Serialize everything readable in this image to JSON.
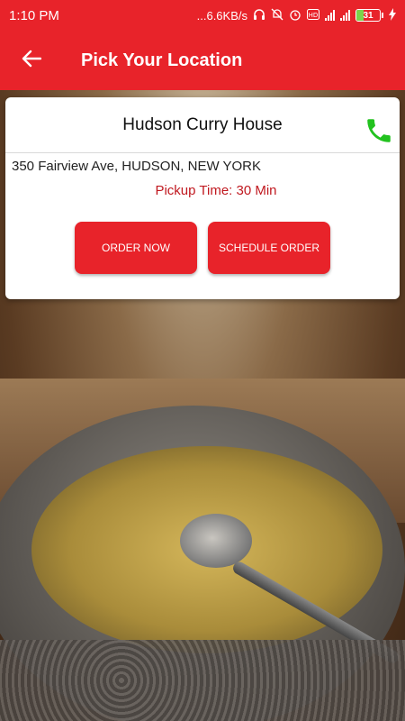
{
  "status_bar": {
    "time": "1:10 PM",
    "network_speed": "...6.6KB/s",
    "battery": "31"
  },
  "app_bar": {
    "title": "Pick Your Location"
  },
  "card": {
    "restaurant_name": "Hudson Curry House",
    "address": "350 Fairview Ave, HUDSON, NEW YORK",
    "pickup_time": "Pickup Time: 30 Min",
    "order_now_label": "ORDER NOW",
    "schedule_order_label": "SCHEDULE ORDER"
  },
  "colors": {
    "brand_red": "#e8232a",
    "pickup_text": "#c0181f",
    "call_icon_green": "#22c21f"
  }
}
